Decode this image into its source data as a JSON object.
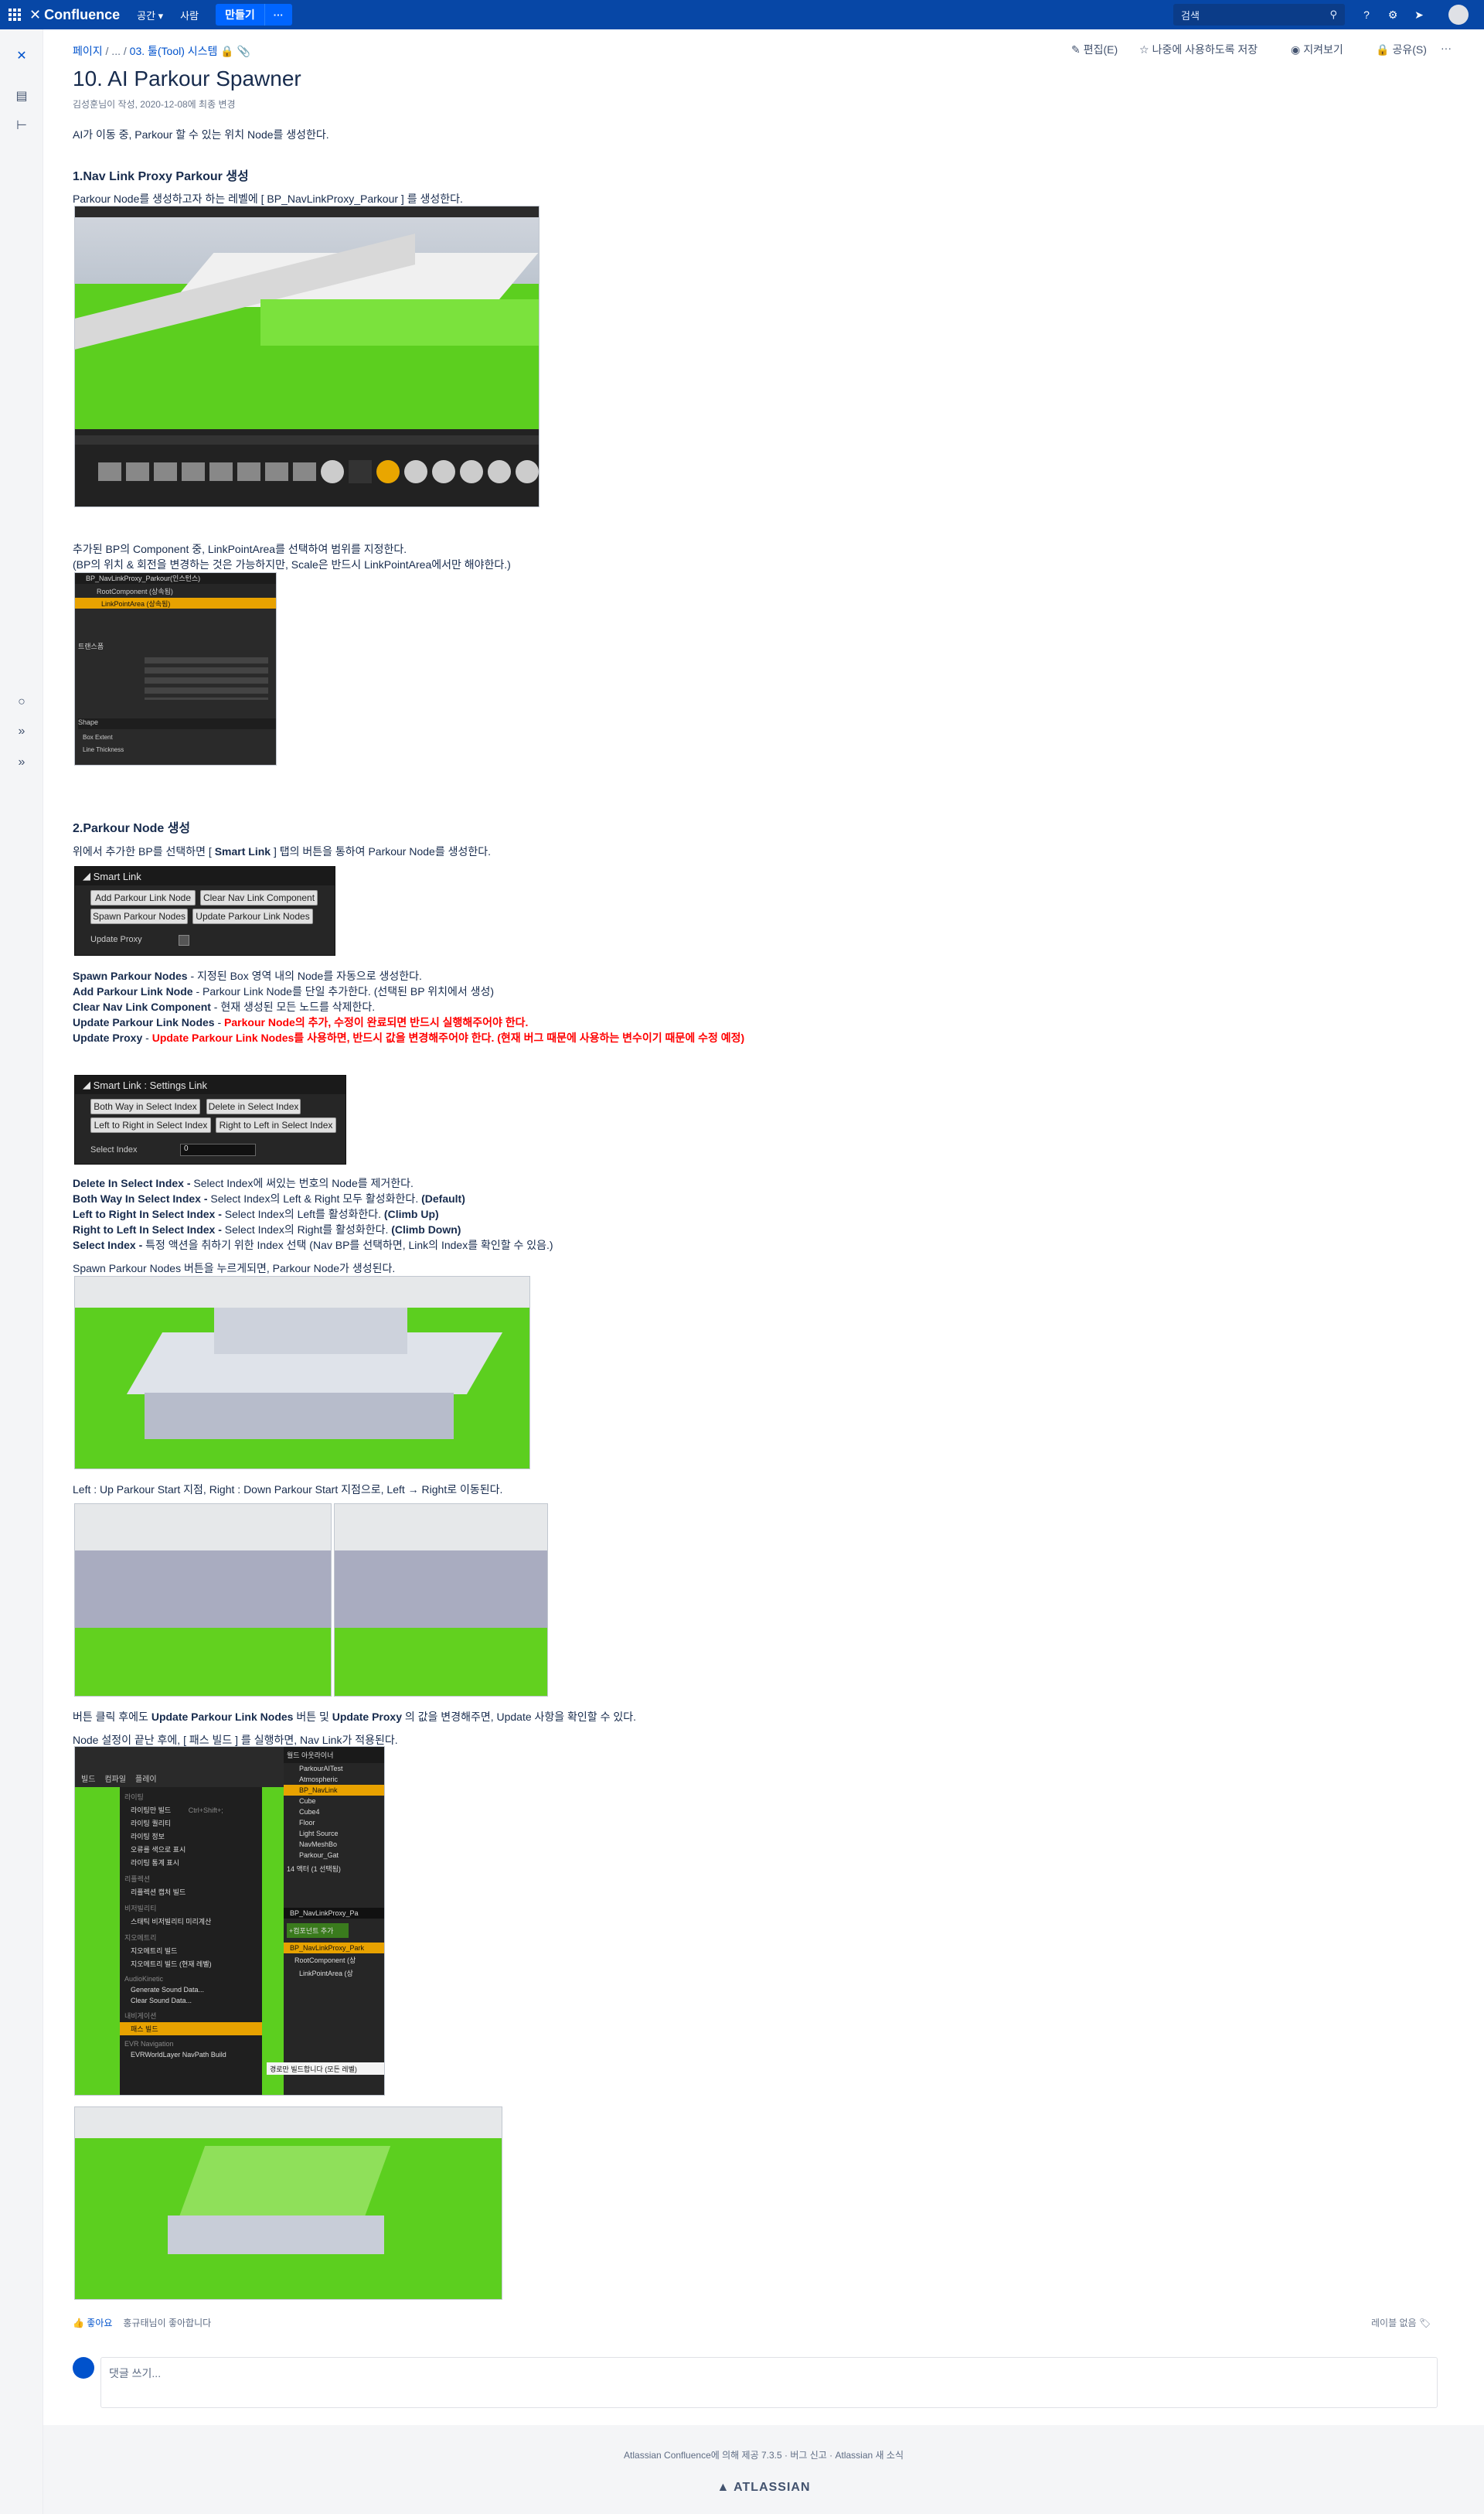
{
  "topnav": {
    "logo": "Confluence",
    "items": [
      "공간",
      "사람"
    ],
    "create": "만들기",
    "more": "···",
    "search_placeholder": "검색"
  },
  "breadcrumb": {
    "root": "페이지",
    "sep1": "/ ...",
    "sep2": "/",
    "current": "03. 툴(Tool) 시스템"
  },
  "page_actions": {
    "edit": "편집(E)",
    "save_later": "나중에 사용하도록 저장",
    "watch": "지켜보기",
    "share": "공유(S)",
    "more": "···"
  },
  "page": {
    "title": "10. AI Parkour Spawner",
    "byline": "김성훈님이 작성, 2020-12-08에 최종 변경",
    "intro": "AI가 이동 중, Parkour 할 수 있는 위치 Node를 생성한다."
  },
  "section1": {
    "heading": "1.Nav Link Proxy Parkour 생성",
    "line1": "Parkour Node를 생성하고자 하는 레벨에 [ BP_NavLinkProxy_Parkour ] 를 생성한다.",
    "line2": "추가된 BP의 Component 중, LinkPointArea를 선택하여 범위를 지정한다.",
    "line3": "(BP의 위치 & 회전을 변경하는 것은 가능하지만, Scale은 반드시 LinkPointArea에서만 해야한다.)",
    "details_title": "BP_NavLinkProxy_Parkour(인스턴스)",
    "root_component": "RootComponent (상속됨)",
    "link_point_area": "LinkPointArea (상속됨)",
    "transform_label": "트랜스폼",
    "shape_label": "Shape",
    "box_extent": "Box Extent",
    "line_thickness": "Line Thickness"
  },
  "section2": {
    "heading": "2.Parkour Node 생성",
    "line1_pre": "위에서 추가한 BP를 선택하면 [ ",
    "line1_b": "Smart Link",
    "line1_post": " ] 탭의 버튼을 통하여 Parkour Node를 생성한다.",
    "smart_link_panel": {
      "title": "Smart Link",
      "buttons": [
        "Add Parkour Link Node",
        "Clear Nav Link Component",
        "Spawn Parkour Nodes",
        "Update Parkour Link Nodes"
      ],
      "update_proxy": "Update Proxy"
    },
    "desc": [
      {
        "b": "Spawn Parkour Nodes",
        "t": " - 지정된 Box 영역 내의 Node를 자동으로 생성한다."
      },
      {
        "b": "Add Parkour Link Node",
        "t": " - Parkour Link Node를 단일 추가한다. (선택된 BP 위치에서 생성)"
      },
      {
        "b": "Clear Nav Link Component",
        "t": " - 현재 생성된 모든 노드를 삭제한다."
      },
      {
        "b": "Update Parkour Link Nodes",
        "t": " - ",
        "r": "Parkour Node의 추가, 수정이 완료되면 반드시 실행해주어야 한다."
      },
      {
        "b": "Update Proxy",
        "t": " - ",
        "r": "Update Parkour Link Nodes를 사용하면, 반드시 값을 변경해주어야 한다. (현재 버그 때문에 사용하는 변수이기 때문에 수정 예정)"
      }
    ],
    "settings_panel": {
      "title": "Smart Link : Settings Link",
      "buttons": [
        "Both Way in Select Index",
        "Delete in Select Index",
        "Left to Right in Select Index",
        "Right to Left in Select Index"
      ],
      "select_index_label": "Select Index",
      "select_index_value": "0"
    },
    "desc2": [
      {
        "b": "Delete In Select Index -",
        "t": " Select Index에 써있는 번호의 Node를 제거한다."
      },
      {
        "b": "Both Way In Select Index -",
        "t": " Select Index의 Left & Right 모두 활성화한다. ",
        "b2": "(Default)"
      },
      {
        "b": "Left to Right In Select Index -",
        "t": " Select Index의 Left를 활성화한다. ",
        "b2": "(Climb Up)"
      },
      {
        "b": "Right to Left In Select Index -",
        "t": " Select Index의 Right를 활성화한다. ",
        "b2": "(Climb Down)"
      },
      {
        "b": "Select Index -",
        "t": " 특정 액션을 취하기 위한 Index 선택 (Nav BP를 선택하면, Link의 Index를 확인할 수 있음.)"
      }
    ],
    "spawn_text": "Spawn Parkour Nodes 버튼을 누르게되면, Parkour Node가 생성된다.",
    "left_right_text": "Left : Up Parkour Start 지점, Right : Down Parkour Start 지점으로, Left → Right로 이동된다.",
    "update_text_pre": "버튼 클릭 후에도 ",
    "update_text_b1": "Update Parkour Link Nodes",
    "update_text_mid": " 버튼 및 ",
    "update_text_b2": "Update Proxy",
    "update_text_post": " 의 값을 변경해주면, Update 사항을 확인할 수 있다.",
    "build_text": "Node 설정이 끝난 후에, [ 패스 빌드 ] 를 실행하면, Nav Link가 적용된다."
  },
  "build_menu": {
    "toolbar": [
      "빌드",
      "컴파일",
      "플레이"
    ],
    "items": [
      "라이팅",
      "라이팅만 빌드",
      "라이팅 퀄리티",
      "라이팅 정보",
      "오류를 색으로 표시",
      "라이팅 통계 표시",
      "리플렉션",
      "리플렉션 캡처 빌드",
      "비저빌리티",
      "스태틱 비저빌리티 미리계산",
      "지오메트리",
      "지오메트리 빌드",
      "지오메트리 빌드 (현재 레벨)",
      "AudioKinetic",
      "Generate Sound Data...",
      "Clear Sound Data...",
      "내비게이션",
      "패스 빌드",
      "EVR Navigation",
      "EVRWorldLayer NavPath Build"
    ],
    "shortcut": "Ctrl+Shift+;",
    "tooltip": "경로만 빌드합니다 (모든 레벨)",
    "outliner_title": "월드 아웃라이너",
    "outliner_items": [
      "ParkourAITest",
      "Atmospheric",
      "BP_NavLink",
      "Cube",
      "Cube4",
      "Floor",
      "Light Source",
      "NavMeshBo",
      "Parkour_Gat"
    ],
    "outliner_count": "14 액터 (1 선택됨)",
    "detail_name": "BP_NavLinkProxy_Pa",
    "add_component": "+컴포넌트 추가",
    "tree": [
      "BP_NavLinkProxy_Park",
      "RootComponent (상",
      "LinkPointArea (상"
    ]
  },
  "footer": {
    "like": "좋아요",
    "like_text": "홍규태님이 좋아합니다",
    "labels": "레이블 없음",
    "comment_placeholder": "댓글 쓰기...",
    "powered": "Atlassian Confluence에 의해 제공 7.3.5",
    "bug": "버그 신고",
    "news": "Atlassian 새 소식",
    "atlassian": "ATLASSIAN"
  }
}
